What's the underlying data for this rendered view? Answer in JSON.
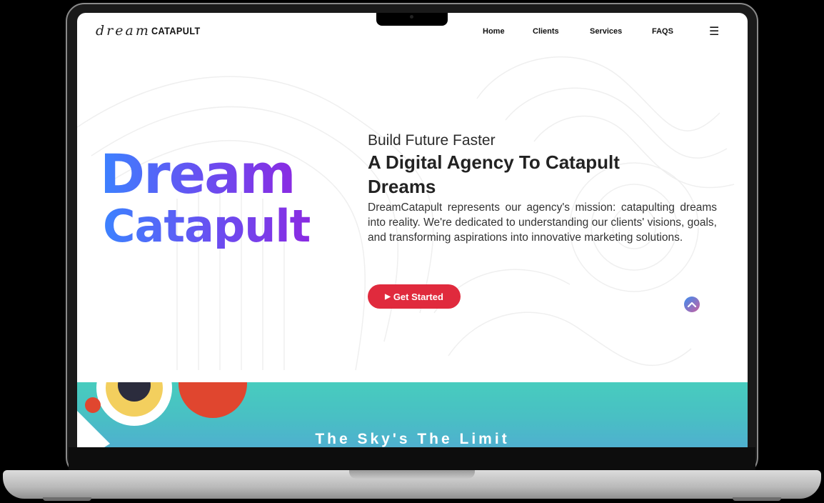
{
  "nav": {
    "logo_script": "dream",
    "logo_bold": "CATAPULT",
    "links": [
      "Home",
      "Clients",
      "Services",
      "FAQS"
    ],
    "menu_icon": "hamburger-menu-icon"
  },
  "hero": {
    "big_word_1": "Dream",
    "big_word_2": "Catapult",
    "kicker": "Build Future Faster",
    "headline": "A Digital Agency To Catapult Dreams",
    "description": "DreamCatapult represents our agency's mission: catapulting dreams into reality. We're dedicated to understanding our clients' visions, goals, and transforming aspirations into innovative marketing solutions.",
    "cta_label": "Get Started",
    "cta_icon": "play-icon",
    "scroll_top_icon": "chevron-up-icon"
  },
  "band": {
    "title": "The Sky's The Limit"
  },
  "colors": {
    "cta": "#e02a3d",
    "band": "#47ccbe",
    "gradient_start": "#3c82ff",
    "gradient_end": "#8a2be2"
  }
}
